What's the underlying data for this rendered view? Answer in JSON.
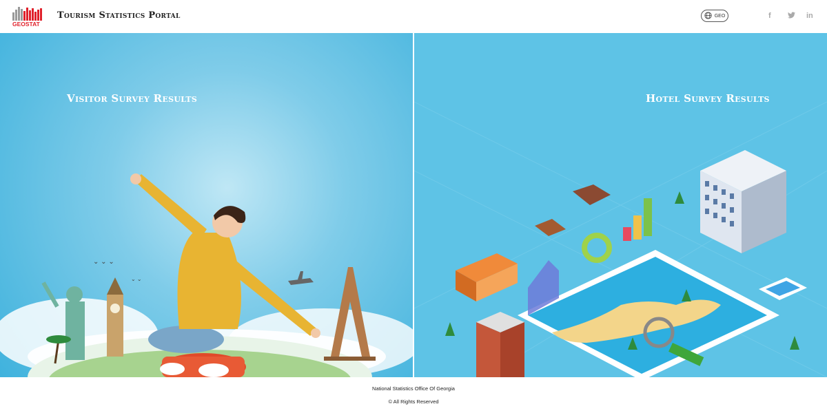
{
  "header": {
    "logo_text": "GEOSTAT",
    "title": "Tourism Statistics Portal",
    "lang_label": "GEO",
    "social": [
      {
        "name": "facebook-icon",
        "glyph": "f"
      },
      {
        "name": "twitter-icon",
        "glyph": "t"
      },
      {
        "name": "linkedin-icon",
        "glyph": "in"
      }
    ]
  },
  "panels": {
    "visitor": {
      "title": "Visitor Survey Results"
    },
    "hotel": {
      "title": "Hotel Survey Results"
    }
  },
  "footer": {
    "org": "National Statistics Office Of Georgia",
    "rights": "© All Rights Reserved"
  },
  "colors": {
    "brand_red": "#e0202a",
    "brand_gray": "#9a9a9a",
    "sky_blue": "#5ec3e6"
  }
}
